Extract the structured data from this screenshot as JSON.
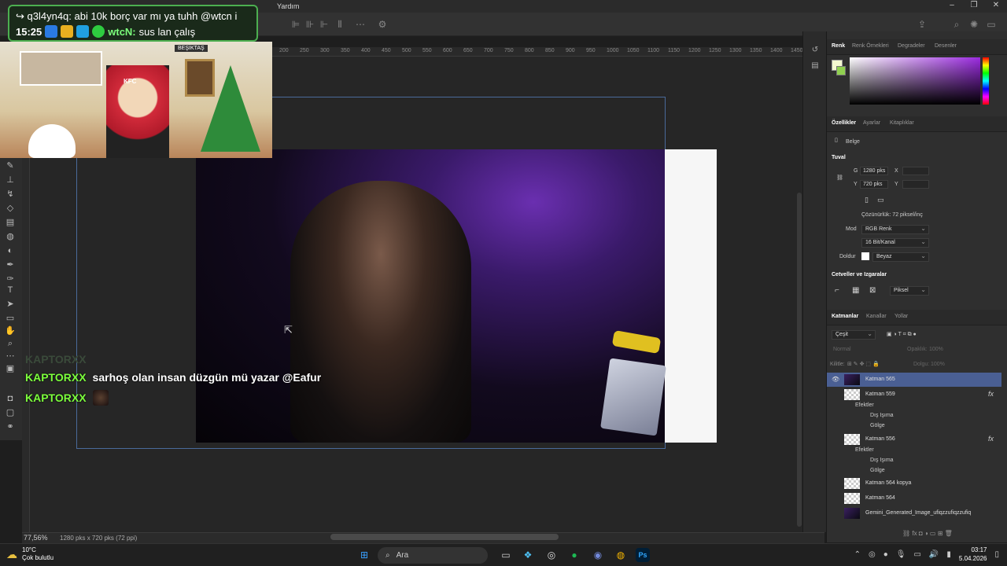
{
  "menu": {
    "help": "Yardım"
  },
  "chat_top": {
    "line1": "↪ q3l4yn4q: abi 10k borç var mı ya tuhh @wtcn i",
    "time": "15:25",
    "user": "wtcN:",
    "message": "sus lan çalış"
  },
  "overlay": {
    "tag": "BEŞİKTAŞ",
    "kfc": "KFC",
    "hat": "KEL4YXX"
  },
  "chat_bottom": {
    "ghost": "KAPTORXX",
    "row1_user": "KAPTORXX",
    "row1_message": "sarhoş olan insan düzgün mü yazar @Eafur",
    "row2_user": "KAPTORXX"
  },
  "ruler": [
    "200",
    "250",
    "300",
    "350",
    "400",
    "450",
    "500",
    "550",
    "600",
    "650",
    "700",
    "750",
    "800",
    "850",
    "900",
    "950",
    "1000",
    "1050",
    "1100",
    "1150",
    "1200",
    "1250",
    "1300",
    "1350",
    "1400",
    "1450"
  ],
  "status": {
    "zoom": "77,56%",
    "doc": "1280 pks x 720 pks (72 ppi)"
  },
  "color_panel": {
    "tabs": [
      "Renk",
      "Renk Örnekleri",
      "Degradeler",
      "Desenler"
    ]
  },
  "properties": {
    "tabs": [
      "Özellikler",
      "Ayarlar",
      "Kitaplıklar"
    ],
    "doc_label": "Belge",
    "canvas_section": "Tuval",
    "w_label": "G",
    "w_value": "1280 pks",
    "x_label": "X",
    "h_label": "Y",
    "h_value": "720 pks",
    "y_label": "Y",
    "resolution": "Çözünürlük: 72 piksel/inç",
    "mode_label": "Mod",
    "mode_value": "RGB Renk",
    "depth_value": "16 Bit/Kanal",
    "fill_label": "Doldur",
    "fill_value": "Beyaz",
    "rulers_section": "Cetveller ve Izgaralar",
    "unit_value": "Piksel"
  },
  "layers_panel": {
    "tabs": [
      "Katmanlar",
      "Kanallar",
      "Yollar"
    ],
    "filter": "Çeşit",
    "blend": "Normal",
    "opacity_label": "Opaklık:",
    "opacity_value": "100%",
    "lock_label": "Kilitle:",
    "fill_label": "Dolgu:",
    "fill_value": "100%",
    "layers": [
      {
        "name": "Katman 565",
        "selected": true,
        "fx": ""
      },
      {
        "name": "Katman 559",
        "selected": false,
        "fx": "fx"
      },
      {
        "name": "Efektler",
        "selected": false,
        "fx": ""
      },
      {
        "name": "Dış Işıma",
        "selected": false,
        "fx": ""
      },
      {
        "name": "Gölge",
        "selected": false,
        "fx": ""
      },
      {
        "name": "Katman 556",
        "selected": false,
        "fx": "fx"
      },
      {
        "name": "Efektler",
        "selected": false,
        "fx": ""
      },
      {
        "name": "Dış Işıma",
        "selected": false,
        "fx": ""
      },
      {
        "name": "Gölge",
        "selected": false,
        "fx": ""
      },
      {
        "name": "Katman 564 kopya",
        "selected": false,
        "fx": ""
      },
      {
        "name": "Katman 564",
        "selected": false,
        "fx": ""
      },
      {
        "name": "Gemini_Generated_Image_ufiqzzufiqzzufiq",
        "selected": false,
        "fx": ""
      }
    ]
  },
  "taskbar": {
    "temp": "10°C",
    "weather": "Çok bulutlu",
    "search": "Ara",
    "time": "03:17",
    "date": "5.04.2026"
  }
}
